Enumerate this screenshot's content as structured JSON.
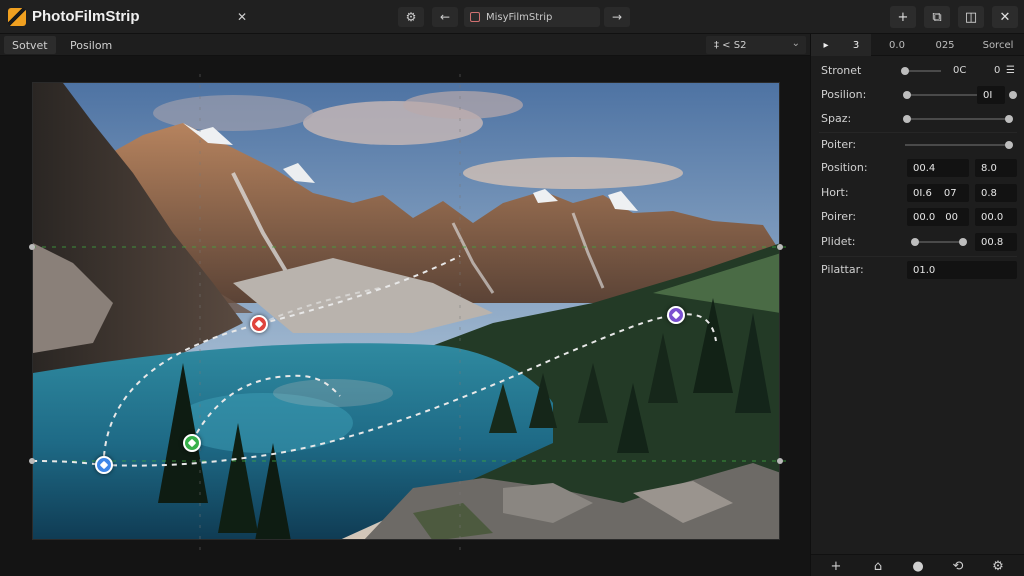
{
  "app": {
    "title": "PhotoFilmStrip"
  },
  "titlebar": {
    "close_label": "✕",
    "field_value": "MisyFilmStrip",
    "back_label": "←",
    "forward_label": "→",
    "win_buttons": [
      "+",
      "⧉",
      "◫",
      "✕"
    ]
  },
  "menubar": {
    "tabs": [
      "Sotvet",
      "Posilom"
    ],
    "select_value": "‡ < S2",
    "select_chevron": "⌄"
  },
  "panel": {
    "tabs": [
      "▸",
      "3",
      "0.0",
      "025",
      "Sorcel"
    ],
    "rows": [
      {
        "label": "Stronet",
        "value1": "0C",
        "value2": "0",
        "slider": 0.1
      },
      {
        "label": "Posilion:",
        "value1": "0I",
        "slider": 0.05
      },
      {
        "label": "Spaz:",
        "slider": 0.02
      },
      {
        "label": "Poiter:",
        "slider": 0.97
      },
      {
        "label": "Position:",
        "value1": "00.4",
        "value2": "8.0"
      },
      {
        "label": "Hort:",
        "value1": "0I.6",
        "value2": "07",
        "value3": "0.8"
      },
      {
        "label": "Poirer:",
        "value1": "00.0",
        "value2": "00",
        "value3": "00.0"
      },
      {
        "label": "Plidet:",
        "value1": "00.8",
        "slider": 0.95
      },
      {
        "label": "Pilattar:",
        "value1": "01.0"
      }
    ],
    "footer": [
      "+",
      "⌂",
      "●",
      "⟲",
      "⚙"
    ]
  },
  "colors": {
    "accent": "#f0a020",
    "keyframe_red": "#e0443c",
    "keyframe_green": "#37b04a",
    "keyframe_blue": "#3d86e8",
    "keyframe_purple": "#7a4fd0",
    "guide_green": "#3fa83f"
  }
}
